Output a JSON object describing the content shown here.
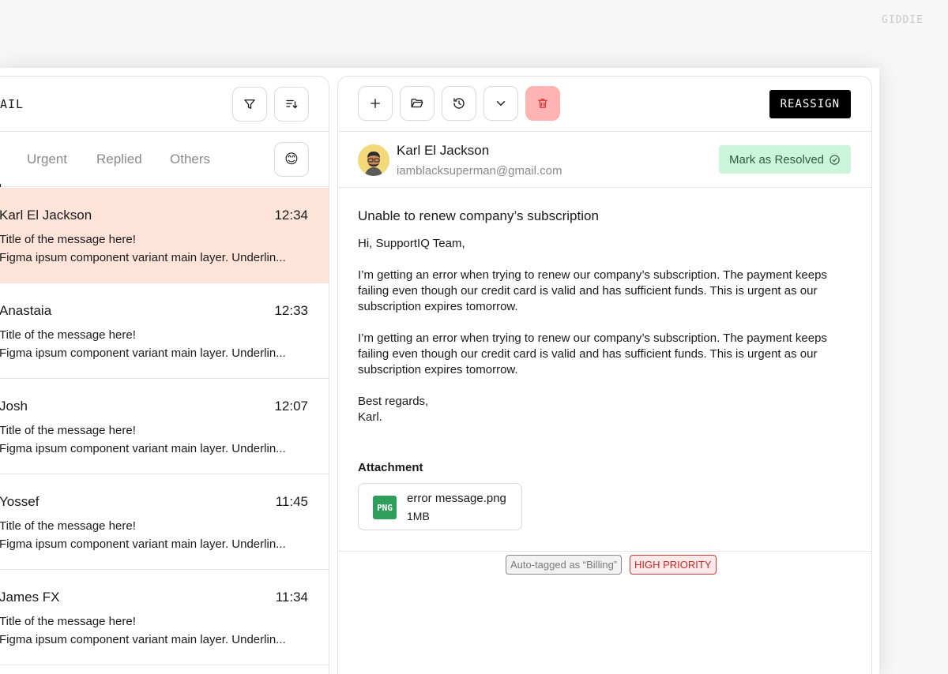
{
  "brand": "GIDDIE",
  "inbox": {
    "title": "AIL",
    "tabs": [
      "Urgent",
      "Replied",
      "Others"
    ],
    "emoji": "😊",
    "messages": [
      {
        "name": "Karl El Jackson",
        "time": "12:34",
        "title": "Title of the message here!",
        "preview": "Figma ipsum component variant main layer. Underlin..."
      },
      {
        "name": "Anastaia",
        "time": "12:33",
        "title": "Title of the message here!",
        "preview": "Figma ipsum component variant main layer. Underlin..."
      },
      {
        "name": "Josh",
        "time": "12:07",
        "title": "Title of the message here!",
        "preview": "Figma ipsum component variant main layer. Underlin..."
      },
      {
        "name": "Yossef",
        "time": "11:45",
        "title": "Title of the message here!",
        "preview": "Figma ipsum component variant main layer. Underlin..."
      },
      {
        "name": "James FX",
        "time": "11:34",
        "title": "Title of the message here!",
        "preview": "Figma ipsum component variant main layer. Underlin..."
      }
    ]
  },
  "toolbar": {
    "reassign_label": "REASSIGN"
  },
  "email": {
    "sender_name": "Karl El Jackson",
    "sender_email": "iamblacksuperman@gmail.com",
    "resolve_label": "Mark as Resolved",
    "subject": "Unable to renew company’s subscription",
    "greeting": "Hi, SupportIQ Team,",
    "para1": "I’m getting an error when trying to renew our company’s subscription. The payment keeps failing even though our credit card is valid and has sufficient funds. This is urgent as our subscription expires tomorrow.",
    "para2": "I’m getting an error when trying to renew our company’s subscription. The payment keeps failing even though our credit card is valid and has sufficient funds. This is urgent as our subscription expires tomorrow.",
    "signoff": "Best regards,",
    "signature": "Karl.",
    "attachment_label": "Attachment",
    "attachment": {
      "type": "PNG",
      "name": "error message.png",
      "size": "1MB"
    }
  },
  "tags": {
    "auto": "Auto-tagged as “Billing”",
    "priority": "HIGH PRIORITY"
  },
  "colors": {
    "active_row": "#fde3d8",
    "resolve_bg": "#ccf5dc",
    "delete_bg": "#ffb3b3",
    "priority": "#c42b2b",
    "png_icon": "#2f9e5b"
  }
}
